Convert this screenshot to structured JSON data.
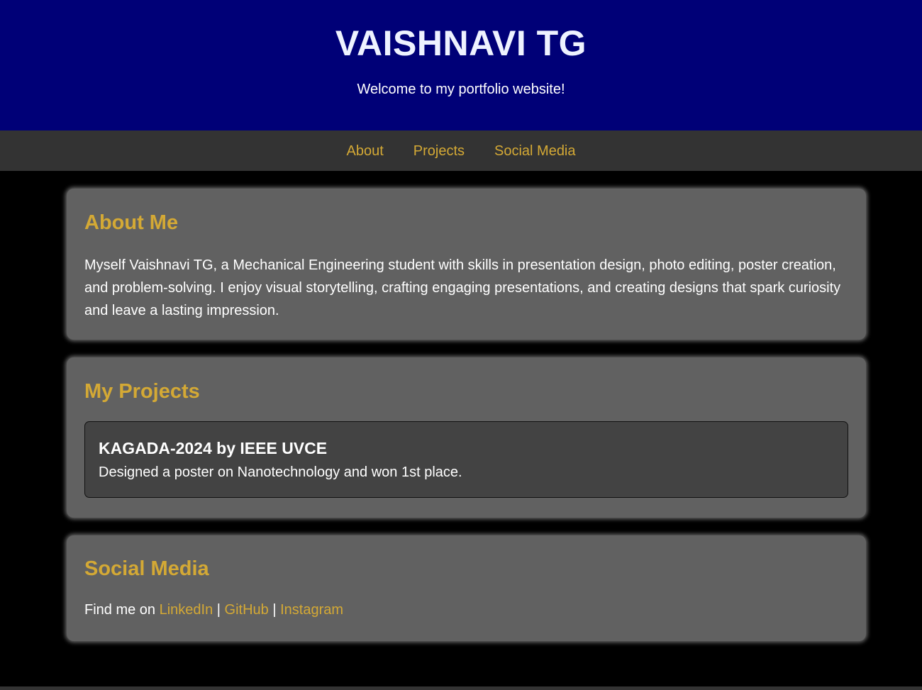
{
  "header": {
    "title": "VAISHNAVI TG",
    "subtitle": "Welcome to my portfolio website!"
  },
  "nav": {
    "items": [
      {
        "label": "About"
      },
      {
        "label": "Projects"
      },
      {
        "label": "Social Media"
      }
    ]
  },
  "about": {
    "heading": "About Me",
    "text": "Myself Vaishnavi TG, a Mechanical Engineering student with skills in presentation design, photo editing, poster creation, and problem-solving. I enjoy visual storytelling, crafting engaging presentations, and creating designs that spark curiosity and leave a lasting impression."
  },
  "projects": {
    "heading": "My Projects",
    "items": [
      {
        "title": "KAGADA-2024 by IEEE UVCE",
        "description": "Designed a poster on Nanotechnology and won 1st place."
      }
    ]
  },
  "social": {
    "heading": "Social Media",
    "prefix": "Find me on ",
    "separator": " | ",
    "links": [
      {
        "label": "LinkedIn"
      },
      {
        "label": "GitHub"
      },
      {
        "label": "Instagram"
      }
    ]
  },
  "colors": {
    "header_bg": "#000077",
    "nav_bg": "#333333",
    "accent": "#d4a935",
    "card_bg": "#616161",
    "project_card_bg": "#434343",
    "page_bg": "#000000"
  }
}
